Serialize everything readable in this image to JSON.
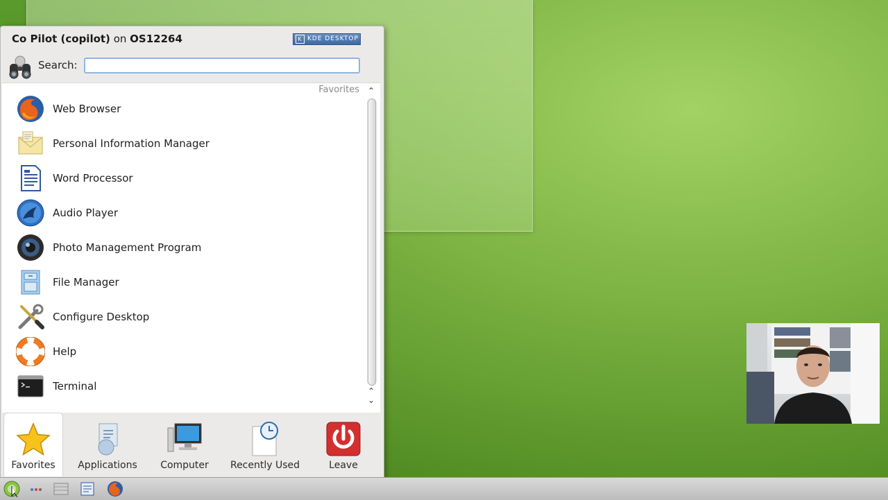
{
  "header": {
    "user_display": "Co Pilot (copilot)",
    "on_word": "on",
    "host": "OS12264",
    "kde_logo": "KDE DESKTOP"
  },
  "search": {
    "label": "Search:",
    "value": "",
    "placeholder": ""
  },
  "section_label": "Favorites",
  "apps": [
    {
      "label": "Web Browser",
      "icon": "firefox-icon"
    },
    {
      "label": "Personal Information Manager",
      "icon": "pim-icon"
    },
    {
      "label": "Word Processor",
      "icon": "word-processor-icon"
    },
    {
      "label": "Audio Player",
      "icon": "audio-player-icon"
    },
    {
      "label": "Photo Management Program",
      "icon": "camera-lens-icon"
    },
    {
      "label": "File Manager",
      "icon": "file-manager-icon"
    },
    {
      "label": "Configure Desktop",
      "icon": "tools-icon"
    },
    {
      "label": "Help",
      "icon": "lifebuoy-icon"
    },
    {
      "label": "Terminal",
      "icon": "terminal-icon"
    }
  ],
  "tabs": [
    {
      "label": "Favorites",
      "icon": "star-icon",
      "active": true
    },
    {
      "label": "Applications",
      "icon": "applications-icon",
      "active": false
    },
    {
      "label": "Computer",
      "icon": "computer-icon",
      "active": false
    },
    {
      "label": "Recently Used",
      "icon": "clock-document-icon",
      "active": false
    },
    {
      "label": "Leave",
      "icon": "power-icon",
      "active": false
    }
  ],
  "taskbar": {
    "items": [
      "kickoff-launcher-icon",
      "pager-icon",
      "show-desktop-icon",
      "file-manager-icon",
      "firefox-icon"
    ]
  },
  "colors": {
    "desktop_green": "#7cb342",
    "search_border": "#8fb5e0",
    "leave_red": "#d32f2f"
  }
}
